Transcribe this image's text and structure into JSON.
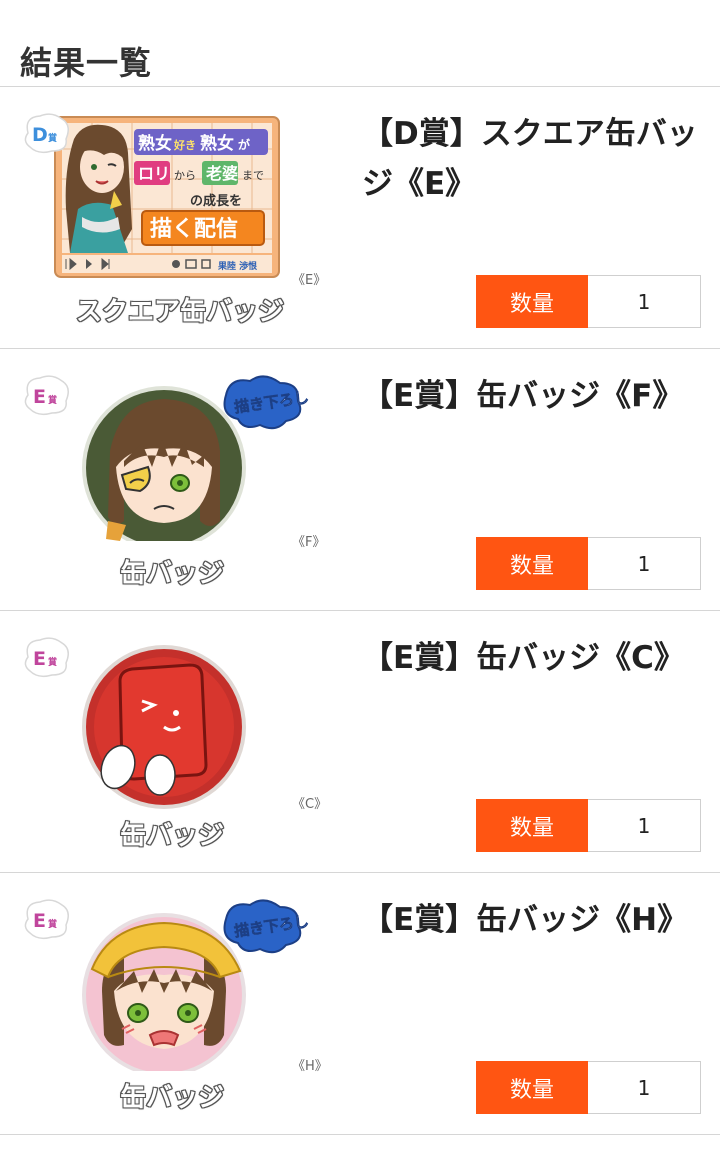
{
  "page": {
    "title": "結果一覧"
  },
  "items": [
    {
      "title": "【D賞】スクエア缶バッジ《E》",
      "grade": "D",
      "grade_suffix": "賞",
      "grade_color": "#3d8fdc",
      "kind_label": "スクエア缶バッジ",
      "variant_tag": "《E》",
      "quantity_label": "数量",
      "quantity": "1",
      "art_text": {
        "line1a": "熟女",
        "line1b": "好き",
        "line1c": "熟女",
        "line1d": "が",
        "line2a": "ロリ",
        "line2b": "から",
        "line2c": "老婆",
        "line2d": "まで",
        "line3": "の成長を",
        "line4": "描く配信",
        "channel": "果陸 渉恨"
      }
    },
    {
      "title": "【E賞】缶バッジ《F》",
      "grade": "E",
      "grade_suffix": "賞",
      "grade_color": "#c0459c",
      "kind_label": "缶バッジ",
      "variant_tag": "《F》",
      "quantity_label": "数量",
      "quantity": "1",
      "art_text": {
        "bubble": "描き下ろし"
      }
    },
    {
      "title": "【E賞】缶バッジ《C》",
      "grade": "E",
      "grade_suffix": "賞",
      "grade_color": "#c0459c",
      "kind_label": "缶バッジ",
      "variant_tag": "《C》",
      "quantity_label": "数量",
      "quantity": "1",
      "art_text": {}
    },
    {
      "title": "【E賞】缶バッジ《H》",
      "grade": "E",
      "grade_suffix": "賞",
      "grade_color": "#c0459c",
      "kind_label": "缶バッジ",
      "variant_tag": "《H》",
      "quantity_label": "数量",
      "quantity": "1",
      "art_text": {
        "bubble": "描き下ろし"
      }
    }
  ]
}
